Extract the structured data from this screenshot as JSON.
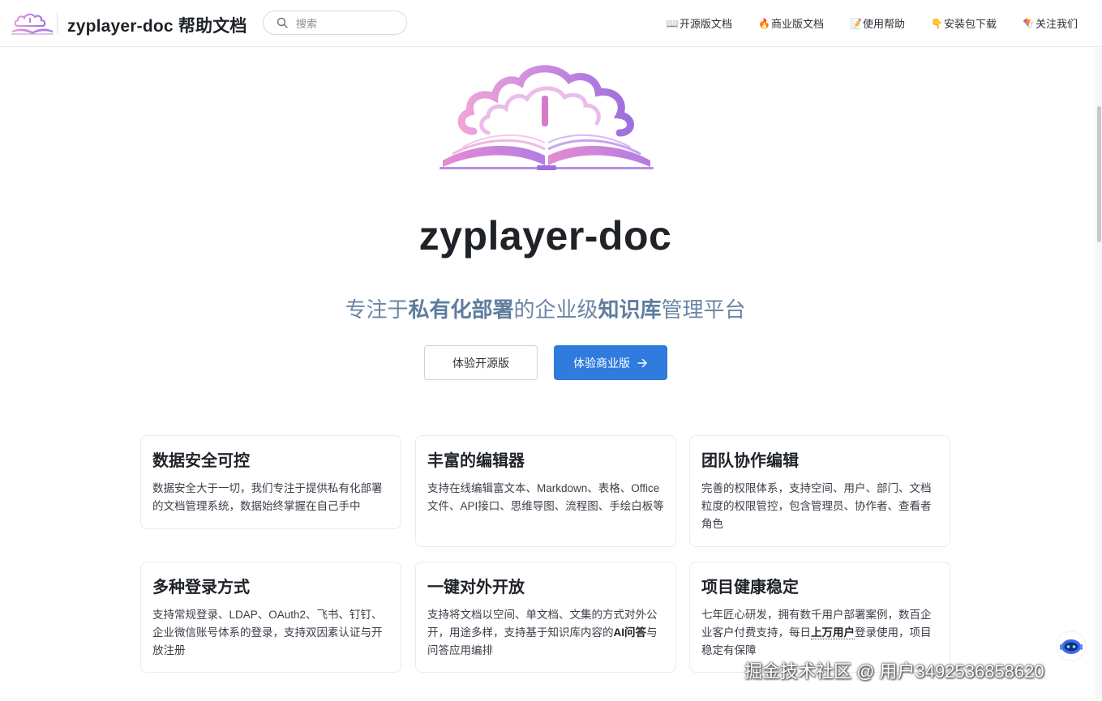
{
  "navbar": {
    "title": "zyplayer-doc 帮助文档",
    "search_placeholder": "搜索",
    "links": [
      {
        "icon": "open-book-icon",
        "emoji": "📖",
        "label": "开源版文档"
      },
      {
        "icon": "fire-icon",
        "emoji": "🔥",
        "label": "商业版文档"
      },
      {
        "icon": "memo-icon",
        "emoji": "📝",
        "label": "使用帮助"
      },
      {
        "icon": "point-down-icon",
        "emoji": "👇",
        "label": "安装包下载"
      },
      {
        "icon": "kite-icon",
        "emoji": "🪁",
        "label": "关注我们"
      }
    ]
  },
  "hero": {
    "name": "zyplayer-doc",
    "tagline": {
      "t1": "专注于",
      "b1": "私有化部署",
      "t2": "的企业级",
      "b2": "知识库",
      "t3": "管理平台"
    },
    "actions": {
      "open_source": "体验开源版",
      "commercial": "体验商业版"
    }
  },
  "features": [
    {
      "title": "数据安全可控",
      "details": "数据安全大于一切，我们专注于提供私有化部署的文档管理系统，数据始终掌握在自己手中"
    },
    {
      "title": "丰富的编辑器",
      "details": "支持在线编辑富文本、Markdown、表格、Office文件、API接口、思维导图、流程图、手绘白板等"
    },
    {
      "title": "团队协作编辑",
      "details": "完善的权限体系，支持空间、用户、部门、文档粒度的权限管控，包含管理员、协作者、查看者角色"
    },
    {
      "title": "多种登录方式",
      "details": "支持常规登录、LDAP、OAuth2、飞书、钉钉、企业微信账号体系的登录，支持双因素认证与开放注册"
    },
    {
      "title": "一键对外开放",
      "details_before": "支持将文档以空间、单文档、文集的方式对外公开，用途多样，支持基于知识库内容的",
      "details_bold": "AI问答",
      "details_after": "与问答应用编排"
    },
    {
      "title": "项目健康稳定",
      "details_before": "七年匠心研发，拥有数千用户部署案例，数百企业客户付费支持，每日",
      "details_bold": "上万用户",
      "details_after": "登录使用，项目稳定有保障"
    }
  ],
  "watermark": "掘金技术社区 @ 用户3492536858620",
  "colors": {
    "accent": "#2f7bde",
    "tagline": "#6b86a5",
    "logo_pink": "#e79ad6",
    "logo_purple": "#9b6fd8"
  }
}
